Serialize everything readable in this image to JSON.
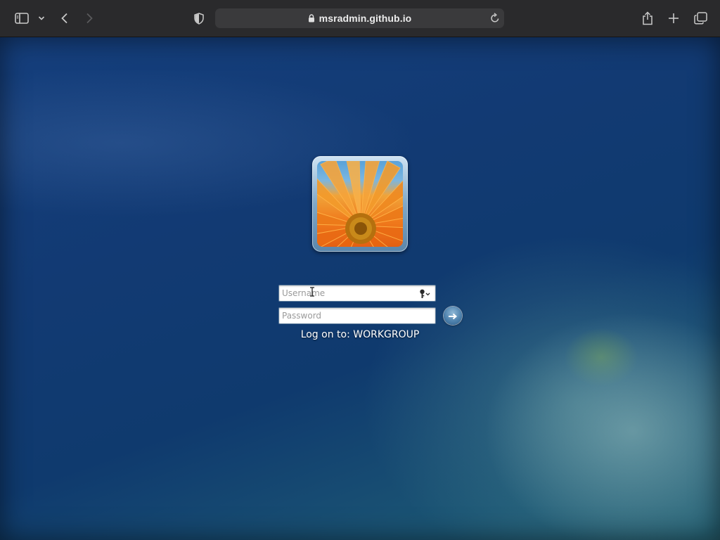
{
  "browser": {
    "url": "msradmin.github.io",
    "icons": {
      "sidebar": "sidebar-icon",
      "tab_group": "chevron-down-icon",
      "back": "back-icon",
      "forward": "forward-icon",
      "privacy": "shield-icon",
      "lock": "lock-icon",
      "reload": "reload-icon",
      "share": "share-icon",
      "new_tab": "plus-icon",
      "tab_overview": "tabs-icon"
    }
  },
  "logon": {
    "username_placeholder": "Username",
    "username_value": "",
    "password_placeholder": "Password",
    "password_value": "",
    "domain_text": "Log on to: WORKGROUP",
    "submit_symbol": "→",
    "avatar": "flower-avatar"
  },
  "colors": {
    "toolbar_bg": "#2a2a2c",
    "desktop_base": "#123a73",
    "accent": "#4f82ad"
  }
}
